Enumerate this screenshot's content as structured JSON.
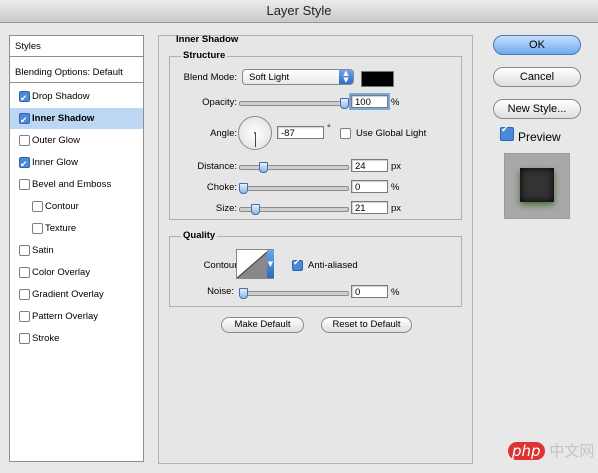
{
  "window": {
    "title": "Layer Style"
  },
  "sidebar": {
    "styles_label": "Styles",
    "blending_label": "Blending Options: Default",
    "items": [
      {
        "label": "Drop Shadow",
        "checked": true,
        "selected": false,
        "indent": false
      },
      {
        "label": "Inner Shadow",
        "checked": true,
        "selected": true,
        "indent": false
      },
      {
        "label": "Outer Glow",
        "checked": false,
        "selected": false,
        "indent": false
      },
      {
        "label": "Inner Glow",
        "checked": true,
        "selected": false,
        "indent": false
      },
      {
        "label": "Bevel and Emboss",
        "checked": false,
        "selected": false,
        "indent": false
      },
      {
        "label": "Contour",
        "checked": false,
        "selected": false,
        "indent": true
      },
      {
        "label": "Texture",
        "checked": false,
        "selected": false,
        "indent": true
      },
      {
        "label": "Satin",
        "checked": false,
        "selected": false,
        "indent": false
      },
      {
        "label": "Color Overlay",
        "checked": false,
        "selected": false,
        "indent": false
      },
      {
        "label": "Gradient Overlay",
        "checked": false,
        "selected": false,
        "indent": false
      },
      {
        "label": "Pattern Overlay",
        "checked": false,
        "selected": false,
        "indent": false
      },
      {
        "label": "Stroke",
        "checked": false,
        "selected": false,
        "indent": false
      }
    ]
  },
  "panel": {
    "title": "Inner Shadow",
    "structure": {
      "title": "Structure",
      "blend_mode_label": "Blend Mode:",
      "blend_mode_value": "Soft Light",
      "shadow_color": "#000000",
      "opacity_label": "Opacity:",
      "opacity_value": "100",
      "opacity_unit": "%",
      "opacity_fraction": 1.0,
      "angle_label": "Angle:",
      "angle_value": "-87",
      "angle_unit": "°",
      "use_global_light_label": "Use Global Light",
      "use_global_light_checked": false,
      "distance_label": "Distance:",
      "distance_value": "24",
      "distance_unit": "px",
      "distance_fraction": 0.2,
      "choke_label": "Choke:",
      "choke_value": "0",
      "choke_unit": "%",
      "choke_fraction": 0,
      "size_label": "Size:",
      "size_value": "21",
      "size_unit": "px",
      "size_fraction": 0.12
    },
    "quality": {
      "title": "Quality",
      "contour_label": "Contour:",
      "anti_aliased_label": "Anti-aliased",
      "anti_aliased_checked": true,
      "noise_label": "Noise:",
      "noise_value": "0",
      "noise_unit": "%",
      "noise_fraction": 0
    },
    "make_default_label": "Make Default",
    "reset_default_label": "Reset to Default"
  },
  "buttons": {
    "ok_label": "OK",
    "cancel_label": "Cancel",
    "new_style_label": "New Style...",
    "preview_label": "Preview",
    "preview_checked": true
  },
  "watermark": {
    "brand": "php",
    "text": "中文网"
  },
  "colors": {
    "accent": "#4a89d8",
    "selection": "#bcd6f4"
  }
}
